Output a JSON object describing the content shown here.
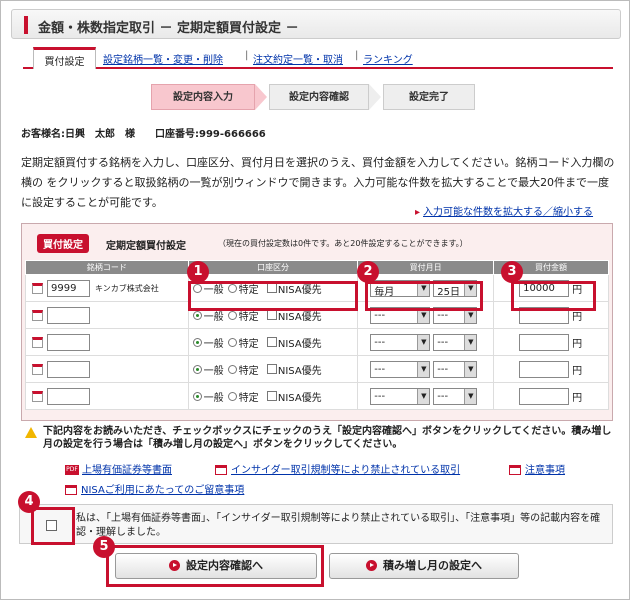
{
  "header": {
    "title": "金額・株数指定取引 － 定期定額買付設定 －"
  },
  "tabs": {
    "active": "買付設定",
    "links": [
      "設定銘柄一覧・変更・削除",
      "注文約定一覧・取消",
      "ランキング"
    ]
  },
  "steps": [
    "設定内容入力",
    "設定内容確認",
    "設定完了"
  ],
  "customer": "お客様名:日興　太郎　様　　口座番号:999-666666",
  "description": "定期定額買付する銘柄を入力し、口座区分、買付月日を選択のうえ、買付金額を入力してください。銘柄コード入力欄の 横の をクリックすると取扱銘柄の一覧が別ウィンドウで開きます。入力可能な件数を拡大することで最大20件まで一度に設定することが可能です。",
  "expand_link": "入力可能な件数を拡大する／縮小する",
  "panel": {
    "badge": "買付設定",
    "title": "定期定額買付設定",
    "note": "（現在の買付設定数は0件です。あと20件設定することができます。）"
  },
  "table": {
    "headers": [
      "銘柄コード",
      "口座区分",
      "買付月日",
      "買付金額"
    ],
    "account_options": [
      "一般",
      "特定",
      "NISA優先"
    ],
    "rows": [
      {
        "code": "9999",
        "company": "キンカブ株式会社",
        "month": "毎月",
        "day": "25日",
        "amount": "10000",
        "selected": ""
      },
      {
        "code": "",
        "company": "",
        "month": "---",
        "day": "---",
        "amount": "",
        "selected": "一般"
      },
      {
        "code": "",
        "company": "",
        "month": "---",
        "day": "---",
        "amount": "",
        "selected": "一般"
      },
      {
        "code": "",
        "company": "",
        "month": "---",
        "day": "---",
        "amount": "",
        "selected": "一般"
      },
      {
        "code": "",
        "company": "",
        "month": "---",
        "day": "---",
        "amount": "",
        "selected": "一般"
      }
    ],
    "yen": "円"
  },
  "callouts": [
    "1",
    "2",
    "3",
    "4",
    "5"
  ],
  "warning": "下記内容をお読みいただき、チェックボックスにチェックのうえ「設定内容確認へ」ボタンをクリックしてください。積み増し月の設定を行う場合は「積み増し月の設定へ」ボタンをクリックしてください。",
  "doc_links": [
    "上場有価証券等書面",
    "インサイダー取引規制等により禁止されている取引",
    "注意事項",
    "NISAご利用にあたってのご留意事項"
  ],
  "pdf_label": "PDF",
  "agreement": "私は、「上場有価証券等書面」、「インサイダー取引規制等により禁止されている取引」、「注意事項」等の記載内容を確認・理解しました。",
  "buttons": {
    "confirm": "設定内容確認へ",
    "monthly": "積み増し月の設定へ"
  },
  "colors": {
    "accent": "#c8102e",
    "link": "#0033aa",
    "panel_bg": "#fbeeee"
  }
}
